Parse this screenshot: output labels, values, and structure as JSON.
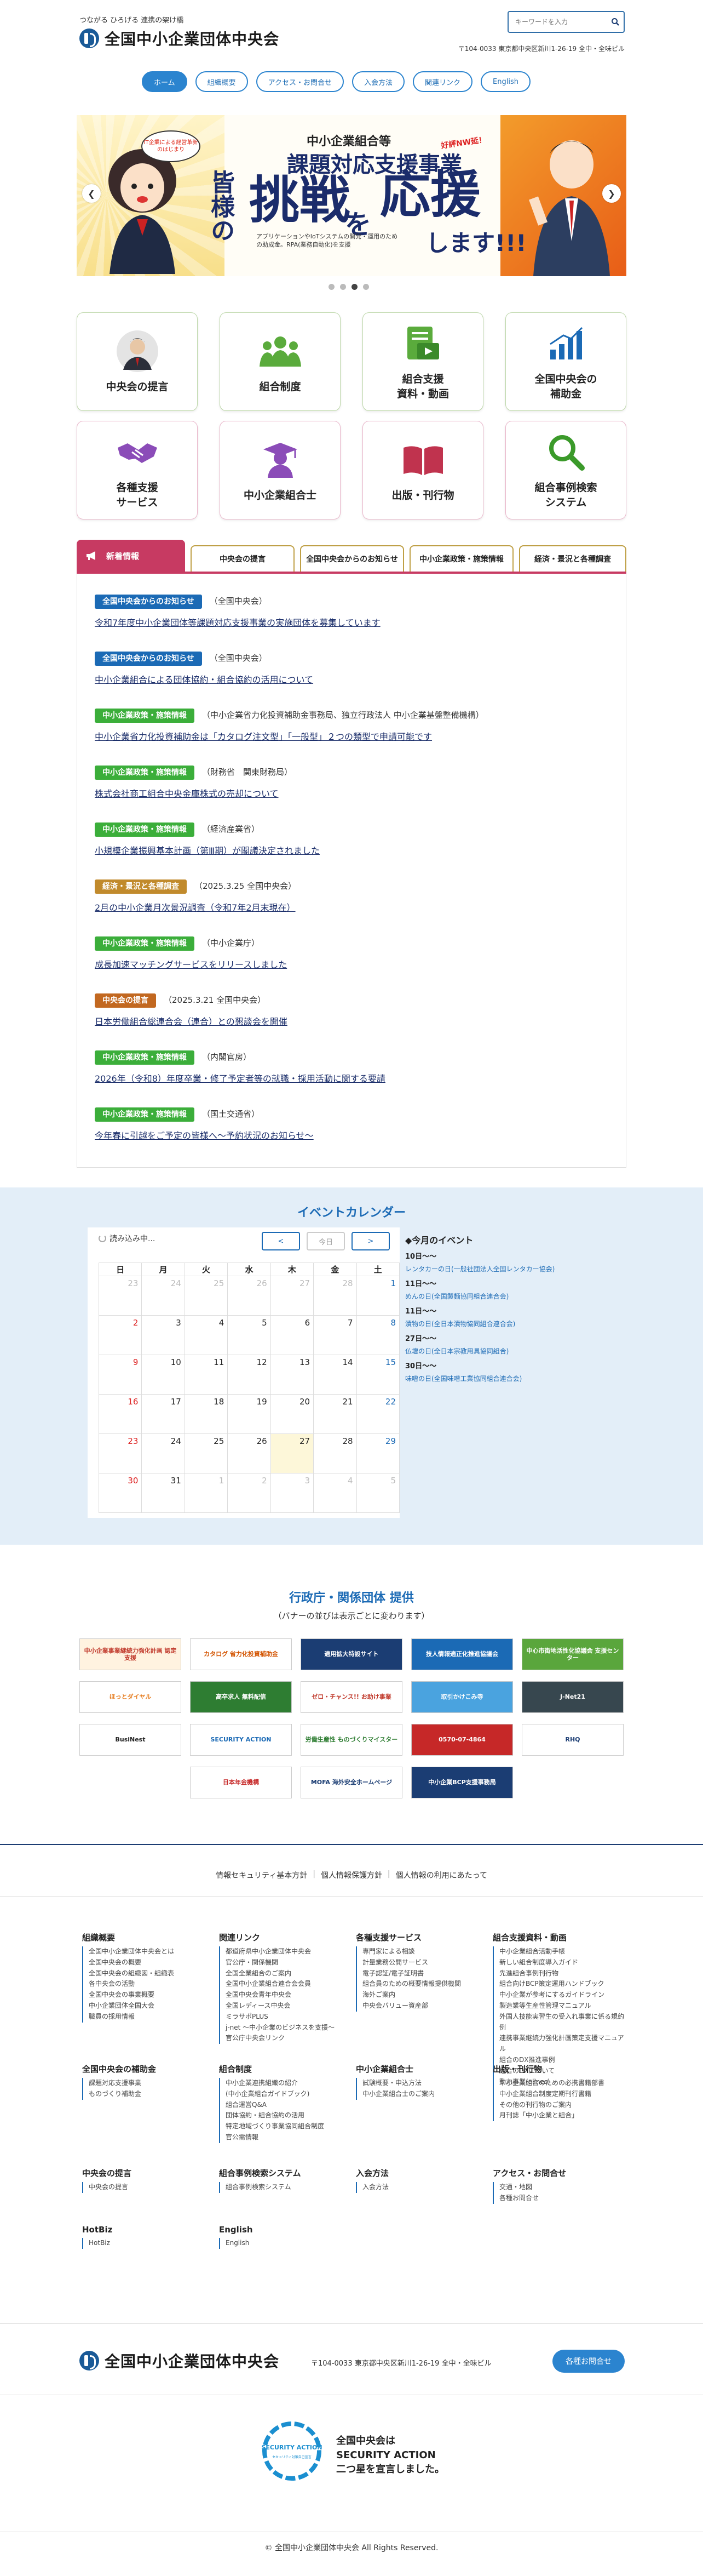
{
  "header": {
    "tagline": "つながる ひろげる 連携の架け橋",
    "logo_text": "全国中小企業団体中央会",
    "search_placeholder": "キーワードを入力",
    "address": "〒104-0033 東京都中央区新川1-26-19 全中・全味ビル"
  },
  "nav": [
    "ホーム",
    "組織概要",
    "アクセス・お問合せ",
    "入会方法",
    "関連リンク",
    "English"
  ],
  "hero": {
    "speech": "IT企業による経営革新のはじまり",
    "title_small": "中小企業組合等",
    "title_main": "課題対応支援事業",
    "badge": "好評NW延！",
    "vertical": "皆様の",
    "big1": "挑戦",
    "wo": "を",
    "big2": "応援",
    "shimasu": "します!!!",
    "sub": "アプリケーションやIoTシステムの開発・運用のための助成金。RPA(業務自動化)を支援"
  },
  "tiles": [
    {
      "label": "中央会の提言",
      "icon": "person-photo-icon"
    },
    {
      "label": "組合制度",
      "icon": "group-icon"
    },
    {
      "label": "組合支援\n資料・動画",
      "icon": "video-document-icon"
    },
    {
      "label": "全国中央会の\n補助金",
      "icon": "bar-chart-icon"
    },
    {
      "label": "各種支援\nサービス",
      "icon": "handshake-icon"
    },
    {
      "label": "中小企業組合士",
      "icon": "graduate-icon"
    },
    {
      "label": "出版・刊行物",
      "icon": "book-icon"
    },
    {
      "label": "組合事例検索\nシステム",
      "icon": "search-icon"
    }
  ],
  "news_tabs": {
    "main": "新着情報",
    "tabs": [
      "中央会の提言",
      "全国中央会からのお知らせ",
      "中小企業政策・施策情報",
      "経済・景況と各種調査"
    ]
  },
  "news": [
    {
      "tag": "全国中央会からのお知らせ",
      "src": "（全国中央会）",
      "title": "令和7年度中小企業団体等課題対応支援事業の実施団体を募集しています"
    },
    {
      "tag": "全国中央会からのお知らせ",
      "src": "（全国中央会）",
      "title": "中小企業組合による団体協約・組合協約の活用について"
    },
    {
      "tag": "中小企業政策・施策情報",
      "src": "（中小企業省力化投資補助金事務局、独立行政法人 中小企業基盤整備機構）",
      "title": "中小企業省力化投資補助金は「カタログ注文型」「一般型」２つの類型で申請可能です"
    },
    {
      "tag": "中小企業政策・施策情報",
      "src": "（財務省　関東財務局）",
      "title": "株式会社商工組合中央金庫株式の売却について"
    },
    {
      "tag": "中小企業政策・施策情報",
      "src": "（経済産業省）",
      "title": "小規模企業振興基本計画（第Ⅲ期）が閣議決定されました"
    },
    {
      "tag": "経済・景況と各種調査",
      "src": "（2025.3.25 全国中央会）",
      "title": "2月の中小企業月次景況調査（令和7年2月末現在）"
    },
    {
      "tag": "中小企業政策・施策情報",
      "src": "（中小企業庁）",
      "title": "成長加速マッチングサービスをリリースしました"
    },
    {
      "tag": "中央会の提言",
      "src": "（2025.3.21 全国中央会）",
      "title": "日本労働組合総連合会（連合）との懇談会を開催"
    },
    {
      "tag": "中小企業政策・施策情報",
      "src": "（内閣官房）",
      "title": "2026年（令和8）年度卒業・修了予定者等の就職・採用活動に関する要請"
    },
    {
      "tag": "中小企業政策・施策情報",
      "src": "（国土交通省）",
      "title": "今年春に引越をご予定の皆様へ～予約状況のお知らせ～"
    }
  ],
  "calendar": {
    "title": "イベントカレンダー",
    "loading": "読み込み中...",
    "prev": "<",
    "today": "今日",
    "next": ">",
    "weekdays": [
      "日",
      "月",
      "火",
      "水",
      "木",
      "金",
      "土"
    ],
    "weeks": [
      [
        "23",
        "24",
        "25",
        "26",
        "27",
        "28",
        "1"
      ],
      [
        "2",
        "3",
        "4",
        "5",
        "6",
        "7",
        "8"
      ],
      [
        "9",
        "10",
        "11",
        "12",
        "13",
        "14",
        "15"
      ],
      [
        "16",
        "17",
        "18",
        "19",
        "20",
        "21",
        "22"
      ],
      [
        "23",
        "24",
        "25",
        "26",
        "27",
        "28",
        "29"
      ],
      [
        "30",
        "31",
        "1",
        "2",
        "3",
        "4",
        "5"
      ]
    ],
    "events_title": "◆今月のイベント",
    "events": [
      {
        "date": "10日〜〜",
        "items": [
          "レンタカーの日(一般社団法人全国レンタカー協会)"
        ]
      },
      {
        "date": "11日〜〜",
        "items": [
          "めんの日(全国製麺協同組合連合会)"
        ]
      },
      {
        "date": "11日〜〜",
        "items": [
          "漬物の日(全日本漬物協同組合連合会)"
        ]
      },
      {
        "date": "27日〜〜",
        "items": [
          "仏壇の日(全日本宗教用具協同組合)"
        ]
      },
      {
        "date": "30日〜〜",
        "items": [
          "味噌の日(全国味噌工業協同組合連合会)"
        ]
      }
    ]
  },
  "banners": {
    "title": "行政庁・関係団体 提供",
    "sub": "（バナーの並びは表示ごとに変わります）",
    "items": [
      {
        "label": "中小企業事業継続力強化計画 認定支援",
        "bg": "#fff3e0",
        "fg": "#c0392b"
      },
      {
        "label": "カタログ 省力化投資補助金",
        "bg": "#fff",
        "fg": "#d35400"
      },
      {
        "label": "適用拡大特設サイト",
        "bg": "#1b3d73",
        "fg": "#fff"
      },
      {
        "label": "技人情報適正化推進協議会",
        "bg": "#1b6ab5",
        "fg": "#fff"
      },
      {
        "label": "中心市街地活性化協議会 支援センター",
        "bg": "#5aa63c",
        "fg": "#fff"
      },
      {
        "label": "ほっとダイヤル",
        "bg": "#fff",
        "fg": "#e67e22"
      },
      {
        "label": "高卒求人 無料配信",
        "bg": "#2e7d32",
        "fg": "#fff"
      },
      {
        "label": "ゼロ・チャンス!! お助け事業",
        "bg": "#fff",
        "fg": "#c0392b"
      },
      {
        "label": "取引かけこみ寺",
        "bg": "#4aa3df",
        "fg": "#fff"
      },
      {
        "label": "J-Net21",
        "bg": "#37474f",
        "fg": "#fff"
      },
      {
        "label": "BusiNest",
        "bg": "#fff",
        "fg": "#222"
      },
      {
        "label": "SECURITY ACTION",
        "bg": "#fff",
        "fg": "#1b6ab5"
      },
      {
        "label": "労働生産性 ものづくりマイスター",
        "bg": "#fff",
        "fg": "#2e7d32"
      },
      {
        "label": "0570-07-4864",
        "bg": "#c62828",
        "fg": "#fff"
      },
      {
        "label": "RHQ",
        "bg": "#fff",
        "fg": "#1b3d73"
      },
      {
        "label": "日本年金機構",
        "bg": "#fff",
        "fg": "#c62828"
      },
      {
        "label": "MOFA 海外安全ホームページ",
        "bg": "#fff",
        "fg": "#1b3d73"
      },
      {
        "label": "中小企業BCP支援事務局",
        "bg": "#1b3d73",
        "fg": "#fff"
      }
    ]
  },
  "policy": [
    "情報セキュリティ基本方針",
    "個人情報保護方針",
    "個人情報の利用にあたって"
  ],
  "sitemap": [
    {
      "head": "組織概要",
      "links": [
        "全国中小企業団体中央会とは",
        "全国中央会の概要",
        "全国中央会の組織図・組織表",
        "各中央会の活動",
        "全国中央会の事業概要",
        "中小企業団体全国大会",
        "職員の採用情報"
      ]
    },
    {
      "head": "関連リンク",
      "links": [
        "都道府県中小企業団体中央会",
        "官公庁・関係機関",
        "全国全業組合のご案内",
        "全国中小企業組合連合会会員",
        "全国中央会青年中央会",
        "全国レディース中央会",
        "ミラサポPLUS",
        "j-net 〜中小企業のビジネスを支援〜",
        "官公庁中央会リンク"
      ]
    },
    {
      "head": "各種支援サービス",
      "links": [
        "専門家による相談",
        "計量業務公開サービス",
        "電子認証/電子証明書",
        "組合員のための概要情報提供機関",
        "海外ご案内",
        "中央会バリュー資産部"
      ]
    },
    {
      "head": "組合支援資料・動画",
      "links": [
        "中小企業組合活動手帳",
        "新しい組合制度導入ガイド",
        "先進組合事例刊行物",
        "組合向けBCP策定運用ハンドブック",
        "中小企業が参考にするガイドライン",
        "製造業等生産性管理マニュアル",
        "外国人技能実習生の受入れ事業に係る規約例",
        "連携事業継続力強化計画策定支援マニュアル",
        "組合のDX推進事例",
        "組合のDXについて",
        "動力事業(elines)"
      ]
    },
    {
      "head": "全国中央会の補助金",
      "links": [
        "課題対応支援事業",
        "ものづくり補助金"
      ]
    },
    {
      "head": "組合制度",
      "links": [
        "中小企業連携組織の紹介",
        "(中小企業組合ガイドブック)",
        "組合運営Q&A",
        "団体協約・組合協約の活用",
        "特定地域づくり事業協同組合制度",
        "官公需情報"
      ]
    },
    {
      "head": "中小企業組合士",
      "links": [
        "試験概要・申込方法",
        "中小企業組合士のご案内"
      ]
    },
    {
      "head": "出版・刊行物",
      "links": [
        "中小企業組合のための必携書籍部書",
        "中小企業組合制度定期刊行書籍",
        "その他の刊行物のご案内",
        "月刊誌「中小企業と組合」"
      ]
    },
    {
      "head": "中央会の提言",
      "links": [
        "中央会の提言"
      ]
    },
    {
      "head": "組合事例検索システム",
      "links": [
        "組合事例検索システム"
      ]
    },
    {
      "head": "入会方法",
      "links": [
        "入会方法"
      ]
    },
    {
      "head": "アクセス・お問合せ",
      "links": [
        "交通・地図",
        "各種お問合せ"
      ]
    },
    {
      "head": "HotBiz",
      "links": [
        "HotBiz"
      ]
    },
    {
      "head": "English",
      "links": [
        "English"
      ]
    }
  ],
  "footer": {
    "logo_text": "全国中小企業団体中央会",
    "address": "〒104-0033 東京都中央区新川1-26-19 全中・全味ビル",
    "contact": "各種お問合せ",
    "sa_text_1": "全国中央会は",
    "sa_text_2": "SECURITY ACTION",
    "sa_text_3": "二つ星を宣言しました。",
    "sa_logo_text": "SECURITY ACTION",
    "sa_logo_sub": "セキュリティ対策自己宣言",
    "copyright": "© 全国中小企業団体中央会 All Rights Reserved."
  }
}
